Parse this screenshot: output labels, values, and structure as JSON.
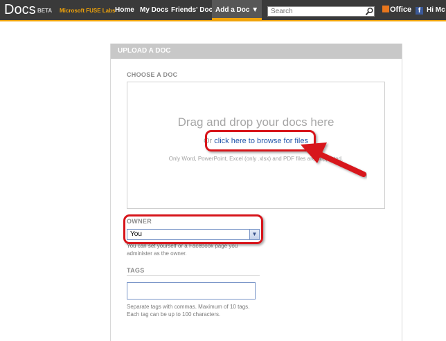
{
  "header": {
    "logo": "Docs",
    "beta": "BETA",
    "brand": "Microsoft FUSE Labs",
    "nav": [
      {
        "label": "Home"
      },
      {
        "label": "My Docs"
      },
      {
        "label": "Friends' Docs"
      },
      {
        "label": "Add a Doc ▼"
      }
    ],
    "search_placeholder": "Search",
    "office": "Office",
    "facebook": "f",
    "greeting": "Hi Mc"
  },
  "panel": {
    "title": "UPLOAD A DOC",
    "choose_label": "CHOOSE A DOC",
    "drag_text": "Drag and drop your docs here",
    "browse_prefix": "Or",
    "browse_link": "click here to browse for files",
    "only_text": "Only Word, PowerPoint, Excel (only .xlsx) and PDF files are supported.",
    "owner_label": "OWNER",
    "owner_value": "You",
    "owner_help": "You can set yourself or a Facebook page you administer as the owner.",
    "tags_label": "TAGS",
    "tags_help": "Separate tags with commas. Maximum of 10 tags. Each tag can be up to 100 characters."
  },
  "colors": {
    "topbar": "#3a3a3a",
    "accent": "#f0a30a",
    "annotation": "#d7141a",
    "link": "#2255aa"
  }
}
